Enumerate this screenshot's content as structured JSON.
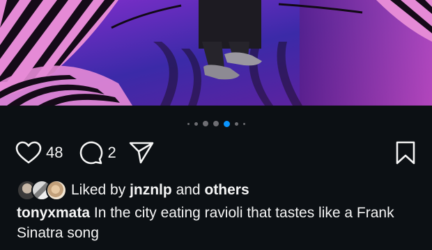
{
  "photo": {
    "alt": "Mirrored room with striped pink and black sculptures and a person standing"
  },
  "carousel": {
    "dots_total": 7,
    "active_index": 4
  },
  "actions": {
    "like_count": "48",
    "comment_count": "2"
  },
  "liked_by": {
    "prefix": "Liked by",
    "user": "jnznlp",
    "connector": "and",
    "others": "others"
  },
  "caption": {
    "username": "tonyxmata",
    "text": "In the city eating ravioli that tastes like a Frank Sinatra song"
  },
  "colors": {
    "background": "#0c1014",
    "accent_blue": "#0a95ff",
    "text": "#f5f5f5"
  }
}
